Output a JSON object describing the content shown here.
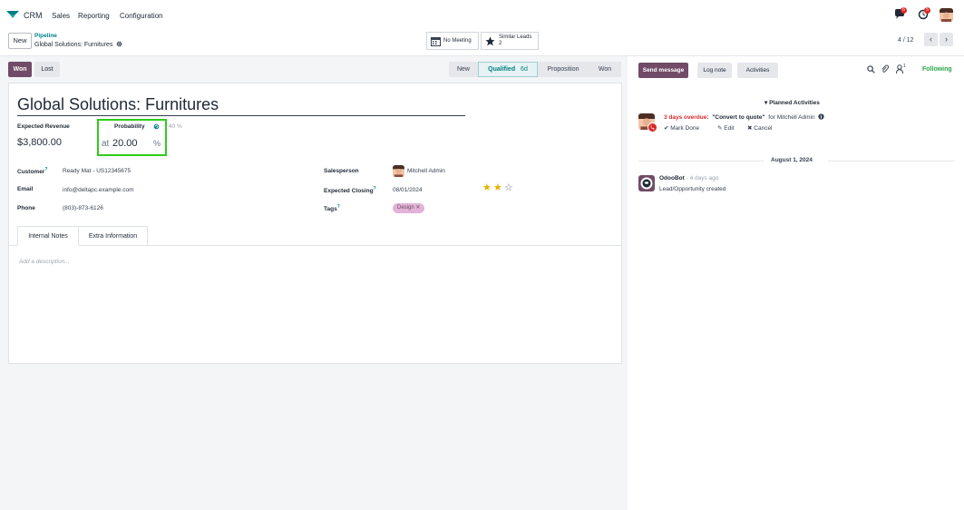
{
  "nav": {
    "app_name": "CRM",
    "menu": [
      "Sales",
      "Reporting",
      "Configuration"
    ],
    "messages_badge": "6",
    "activities_badge": "5"
  },
  "control": {
    "new_label": "New",
    "breadcrumb_parent": "Pipeline",
    "breadcrumb_current": "Global Solutions: Furnitures",
    "meeting_label": "No Meeting",
    "similar_leads_label": "Similar Leads",
    "similar_leads_count": "2",
    "pager": "4 / 12"
  },
  "status": {
    "won_label": "Won",
    "lost_label": "Lost",
    "stages": [
      "New",
      "Qualified",
      "Proposition",
      "Won"
    ],
    "active_stage_duration": "6d"
  },
  "form": {
    "title": "Global Solutions: Furnitures",
    "expected_revenue_label": "Expected Revenue",
    "expected_revenue": "$3,800.00",
    "probability_label": "Probability",
    "probability_hint": "40 %",
    "probability_at": "at",
    "probability_value": "20.00",
    "probability_pct": "%",
    "customer_label": "Customer",
    "customer": "Ready Mat - US12345675",
    "email_label": "Email",
    "email": "info@deltapc.example.com",
    "phone_label": "Phone",
    "phone": "(803)-873-6126",
    "salesperson_label": "Salesperson",
    "salesperson": "Mitchell Admin",
    "expected_closing_label": "Expected Closing",
    "expected_closing": "08/01/2024",
    "priority_stars": 2,
    "tags_label": "Tags",
    "tag": "Design",
    "tabs": [
      "Internal Notes",
      "Extra Information"
    ],
    "description_placeholder": "Add a description..."
  },
  "chatter": {
    "send_message": "Send message",
    "log_note": "Log note",
    "activities": "Activities",
    "followers_count": "1",
    "following": "Following",
    "planned_activities": "Planned Activities",
    "overdue_text": "3 days overdue:",
    "activity_summary": "\"Convert to quote\"",
    "activity_for": "for Mitchell Admin",
    "mark_done": "Mark Done",
    "edit": "Edit",
    "cancel": "Cancel",
    "date_divider": "August 1, 2024",
    "msg_author": "OdooBot",
    "msg_time": "- 4 days ago",
    "msg_body": "Lead/Opportunity created"
  },
  "colors": {
    "brand": "#714b67",
    "accent_teal": "#017e84",
    "highlight_green": "#2ecc1a",
    "following_green": "#28a745",
    "overdue_red": "#dc2626"
  }
}
